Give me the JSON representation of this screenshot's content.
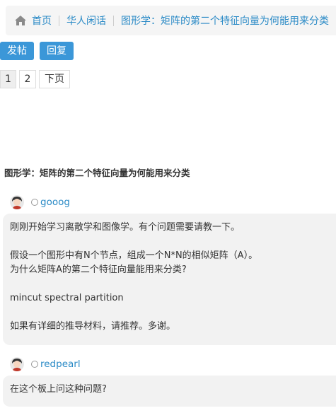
{
  "breadcrumb": {
    "home": "首页",
    "forum": "华人闲话",
    "current": "图形学：矩阵的第二个特征向量为何能用来分类"
  },
  "actions": {
    "new_post": "发帖",
    "reply": "回复"
  },
  "pagination": {
    "pages": [
      "1",
      "2"
    ],
    "current": "1",
    "next": "下页"
  },
  "topic": {
    "title": "图形学：矩阵的第二个特征向量为何能用来分类"
  },
  "posts": [
    {
      "author": "gooog",
      "lines": [
        "刚刚开始学习离散学和图像学。有个问题需要请教一下。",
        "",
        "假设一个图形中有N个节点，组成一个N*N的相似矩阵（A）。",
        "为什么矩阵A的第二个特征向量能用来分类?",
        "",
        "mincut spectral partition",
        "",
        "如果有详细的推导材料，请推荐。多谢。"
      ]
    },
    {
      "author": "redpearl",
      "lines": [
        "在这个板上问这种问题?"
      ]
    }
  ],
  "colors": {
    "link": "#2a8ac6",
    "button": "#3b97d8",
    "post_bg": "#f2f2f2"
  }
}
